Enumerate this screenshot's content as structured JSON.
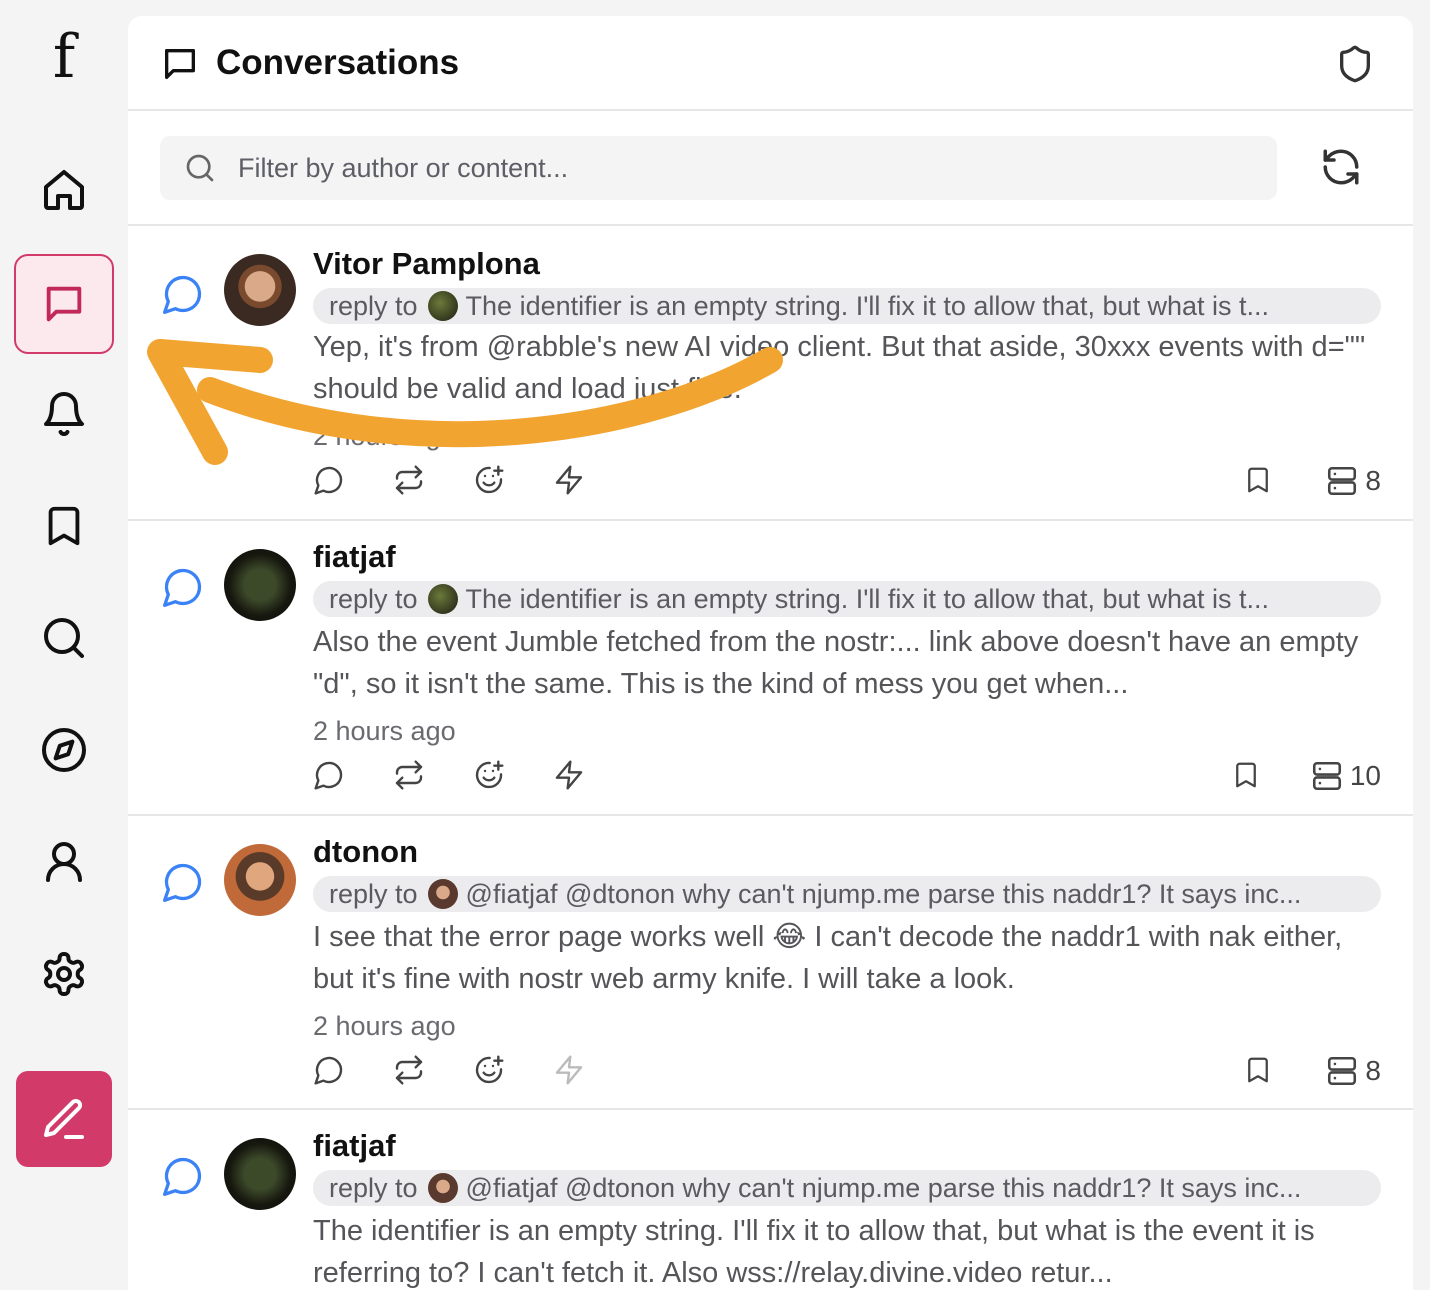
{
  "sidebar": {
    "logo": "f",
    "nav": [
      {
        "name": "nav-home",
        "icon": "home-icon"
      },
      {
        "name": "nav-conversations",
        "icon": "chat-icon",
        "active": true
      },
      {
        "name": "nav-notifications",
        "icon": "bell-icon"
      },
      {
        "name": "nav-bookmarks",
        "icon": "bookmark-icon"
      },
      {
        "name": "nav-search",
        "icon": "search-icon"
      },
      {
        "name": "nav-explore",
        "icon": "compass-icon"
      },
      {
        "name": "nav-profile",
        "icon": "user-icon"
      },
      {
        "name": "nav-settings",
        "icon": "gear-icon"
      }
    ],
    "compose_icon": "pen-icon",
    "accent": "#d23a69"
  },
  "header": {
    "title": "Conversations",
    "right_icon": "shield-icon"
  },
  "search": {
    "placeholder": "Filter by author or content...",
    "refresh_icon": "refresh-icon"
  },
  "posts": [
    {
      "author": "Vitor Pamplona",
      "reply_prefix": "reply to",
      "reply_text": "The identifier is an empty string. I'll fix it to allow that, but what is t...",
      "content": "Yep, it's from @rabble's new AI video client. But that aside, 30xxx events with d=\"\" should be valid and load just fine.",
      "time": "2 hours ago",
      "relay_count": "8"
    },
    {
      "author": "fiatjaf",
      "reply_prefix": "reply to",
      "reply_text": "The identifier is an empty string. I'll fix it to allow that, but what is t...",
      "content": "Also the event Jumble fetched from the nostr:... link above doesn't have an empty \"d\", so it isn't the same. This is the kind of mess you get when...",
      "time": "2 hours ago",
      "relay_count": "10"
    },
    {
      "author": "dtonon",
      "reply_prefix": "reply to",
      "reply_text": "@fiatjaf @dtonon why can't njump.me parse this naddr1? It says inc...",
      "content": "I see that the error page works well 😂 I can't decode the naddr1 with nak either, but it's fine with nostr web army knife. I will take a look.",
      "time": "2 hours ago",
      "relay_count": "8"
    },
    {
      "author": "fiatjaf",
      "reply_prefix": "reply to",
      "reply_text": "@fiatjaf @dtonon why can't njump.me parse this naddr1? It says inc...",
      "content": "The identifier is an empty string. I'll fix it to allow that, but what is the event it is referring to? I can't fetch it. Also wss://relay.divine.video retur...",
      "time": "",
      "relay_count": ""
    }
  ],
  "annotation": {
    "arrow_color": "#f2a431"
  }
}
